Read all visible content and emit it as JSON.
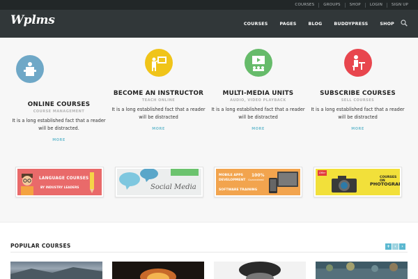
{
  "topbar": {
    "links": [
      "COURSES",
      "GROUPS",
      "SHOP",
      "LOGIN",
      "SIGN UP"
    ]
  },
  "header": {
    "logo": "Wplms",
    "nav": [
      "COURSES",
      "PAGES",
      "BLOG",
      "BUDDYPRESS",
      "SHOP"
    ],
    "search_icon": "search-icon"
  },
  "features": [
    {
      "title": "ONLINE COURSES",
      "subtitle": "COURSE MANAGEMENT",
      "desc": "It is a long established fact that a reader will be distracted.",
      "more": "MORE",
      "icon": "lecture-podium-icon",
      "color": "#6fa8c7"
    },
    {
      "title": "BECOME AN INSTRUCTOR",
      "subtitle": "TEACH ONLINE",
      "desc": "It is a long established fact that a reader will be distracted",
      "more": "MORE",
      "icon": "instructor-board-icon",
      "color": "#f0c419"
    },
    {
      "title": "MULTI-MEDIA UNITS",
      "subtitle": "AUDIO, VIDEO PLAYBACK",
      "desc": "It is a long established fact that a reader will be distracted",
      "more": "MORE",
      "icon": "video-screen-icon",
      "color": "#66bb6a"
    },
    {
      "title": "SUBSCRIBE COURSES",
      "subtitle": "SELL COURSES",
      "desc": "It is a long established fact that a reader will be distracted",
      "more": "MORE",
      "icon": "student-desk-icon",
      "color": "#e8464e"
    }
  ],
  "banners": {
    "language": {
      "line1": "LANGUAGE COURSES",
      "line2": "BY INDUSTRY LEADERS"
    },
    "social": {
      "text": "Social Media"
    },
    "mobile": {
      "line1": "MOBILE APPS",
      "line2": "DEVELOPMENT",
      "badge": "100%",
      "badge_sub": "Guaranteed",
      "line3": "SOFTWARE TRAINING"
    },
    "photo": {
      "tag": "Offer",
      "line1": "COURSES ON",
      "line2": "PHOTOGRAPHY"
    }
  },
  "popular": {
    "title": "POPULAR COURSES"
  },
  "colors": {
    "topbar": "#222728",
    "header": "#313739",
    "accent": "#74bfd1",
    "arrow_active": "#5bb8d0",
    "arrow_inactive": "#9fd3e0"
  }
}
